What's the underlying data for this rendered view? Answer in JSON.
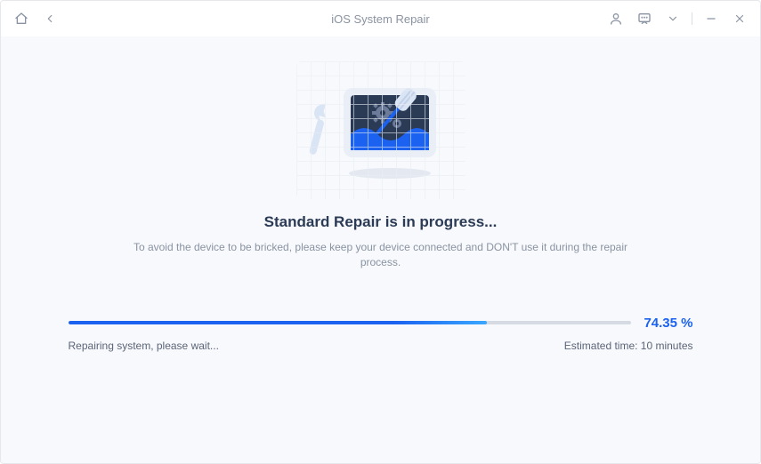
{
  "titlebar": {
    "title": "iOS System Repair"
  },
  "main": {
    "heading": "Standard Repair is in progress...",
    "subtext": "To avoid the device to be bricked, please keep your device connected and DON'T use it during the repair process."
  },
  "progress": {
    "percent_display": "74.35 %",
    "percent_value": 74.35,
    "status_text": "Repairing system, please wait...",
    "estimated_label": "Estimated time: 10 minutes"
  }
}
